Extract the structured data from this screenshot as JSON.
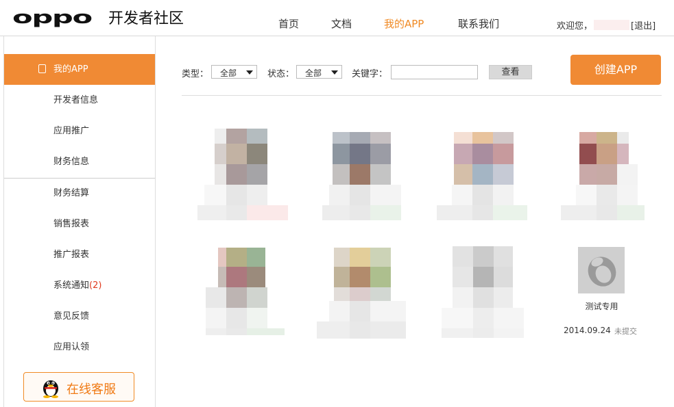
{
  "header": {
    "logo_mark": "oppo",
    "logo_text": "开发者社区",
    "nav": [
      {
        "label": "首页"
      },
      {
        "label": "文档"
      },
      {
        "label": "我的APP"
      },
      {
        "label": "联系我们"
      }
    ],
    "active_nav": "我的APP",
    "welcome": "欢迎您，",
    "logout": "[退出]"
  },
  "sidebar": {
    "items": [
      {
        "label": "我的APP",
        "active": true
      },
      {
        "label": "开发者信息"
      },
      {
        "label": "应用推广"
      },
      {
        "label": "财务信息"
      },
      {
        "label": "财务结算"
      },
      {
        "label": "销售报表"
      },
      {
        "label": "推广报表"
      },
      {
        "label": "系统通知"
      },
      {
        "label": "意见反馈"
      },
      {
        "label": "应用认领"
      }
    ],
    "notification_count": "(2)",
    "service_button": "在线客服"
  },
  "filters": {
    "type_label": "类型：",
    "type_value": "全部",
    "status_label": "状态：",
    "status_value": "全部",
    "keyword_label": "关键字：",
    "keyword_value": "",
    "view_button": "查看"
  },
  "create_button": "创建APP",
  "apps": [
    {
      "name": "测试专用",
      "date": "2014.09.24",
      "status": "未提交"
    }
  ],
  "colors": {
    "accent": "#f08a34",
    "notification": "#e03a1e"
  }
}
